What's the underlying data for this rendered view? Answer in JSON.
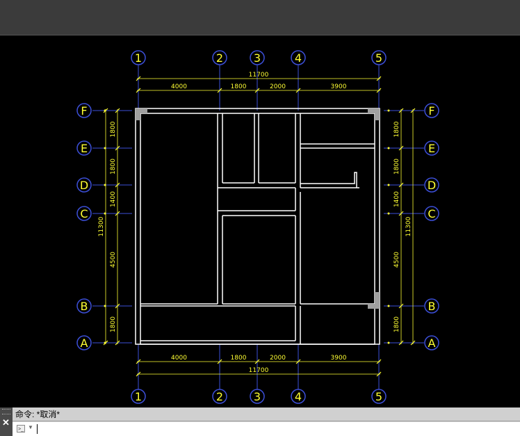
{
  "drawing": {
    "grid_columns": [
      "1",
      "2",
      "3",
      "4",
      "5"
    ],
    "grid_rows": [
      "F",
      "E",
      "D",
      "C",
      "B",
      "A"
    ],
    "horizontal_dims": [
      "4000",
      "1800",
      "2000",
      "3900"
    ],
    "horizontal_total": "11700",
    "vertical_dims": [
      "1800",
      "1800",
      "1400",
      "4500",
      "1800"
    ],
    "vertical_total": "11300",
    "colors": {
      "background": "#000000",
      "bubble": "#3c4fd8",
      "grid_label": "#ffff33",
      "dimension": "#ffff33",
      "wall": "#ffffff",
      "column": "#a0a0a0"
    }
  },
  "command_line": {
    "history": "命令: *取消*",
    "input_value": "",
    "prompt_icon": "command-prompt-icon",
    "close_icon": "close-icon"
  }
}
